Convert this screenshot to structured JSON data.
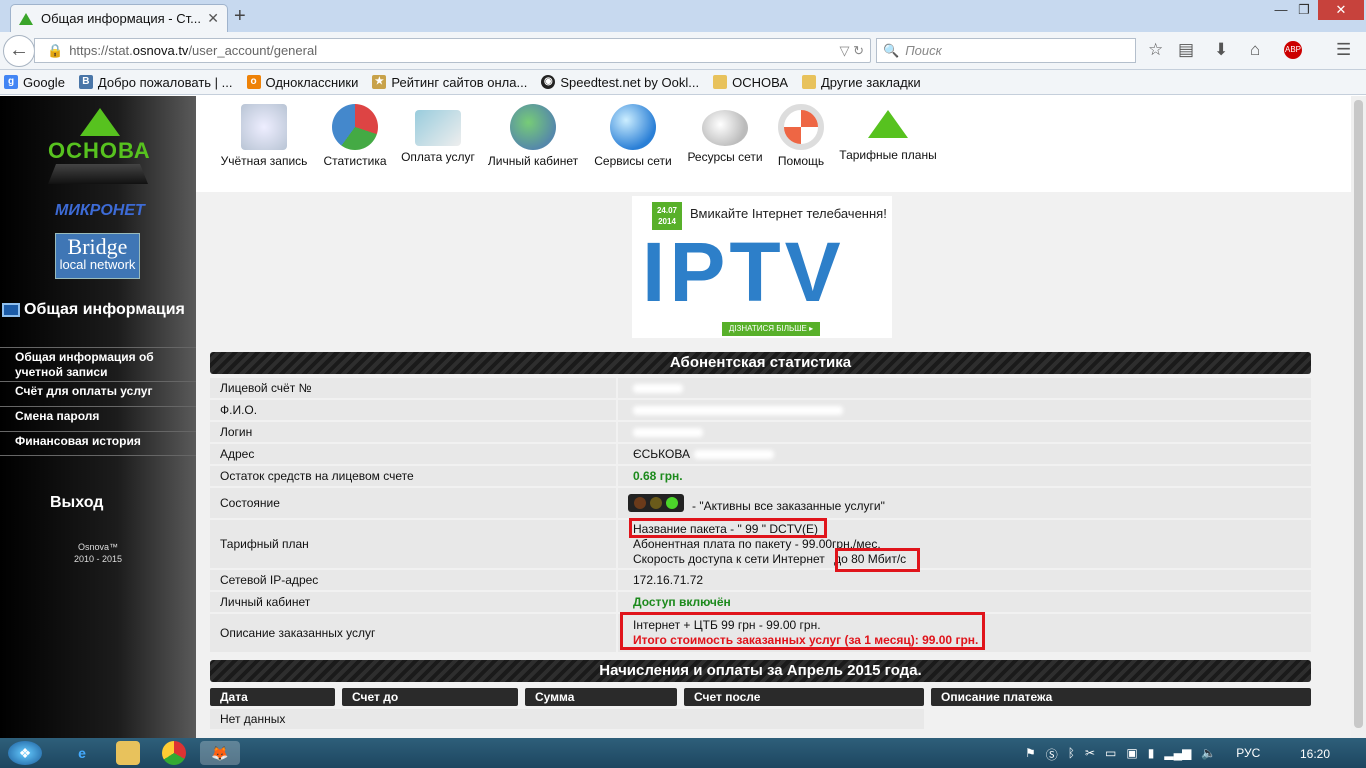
{
  "browser": {
    "tab_title": "Общая информация - Ст...",
    "url_prefix": "https://stat.",
    "url_domain": "osnova.tv",
    "url_path": "/user_account/general",
    "search_placeholder": "Поиск",
    "bookmarks": [
      {
        "label": "Google",
        "icon": "google-icon",
        "color": "#4285f4"
      },
      {
        "label": "Добро пожаловать | ...",
        "icon": "vk-icon",
        "color": "#4a76a8"
      },
      {
        "label": "Одноклассники",
        "icon": "odnoklassniki-icon",
        "color": "#ee8208"
      },
      {
        "label": "Рейтинг сайтов онла...",
        "icon": "rating-icon",
        "color": "#c8a24a"
      },
      {
        "label": "Speedtest.net by Ookl...",
        "icon": "speedtest-icon",
        "color": "#222"
      },
      {
        "label": "ОСНОВА",
        "icon": "folder-icon",
        "color": "#e8c25c"
      },
      {
        "label": "Другие закладки",
        "icon": "folder-icon",
        "color": "#e8c25c"
      }
    ]
  },
  "sidebar": {
    "logo_text": "ОСНОВА",
    "mikronet": "МИКРОНЕТ",
    "bridge_line1": "Bridge",
    "bridge_line2": "local network",
    "section_title": "Общая информация",
    "links": [
      "Общая информация об учетной записи",
      "Счёт для оплаты услуг",
      "Смена пароля",
      "Финансовая история"
    ],
    "logout": "Выход",
    "copyright_line1": "Osnova™",
    "copyright_line2": "2010 - 2015"
  },
  "nav": [
    "Учётная запись",
    "Статистика",
    "Оплата услуг",
    "Личный кабинет",
    "Сервисы сети",
    "Ресурсы сети",
    "Помощь",
    "Тарифные планы"
  ],
  "banner": {
    "date": "24.07 2014",
    "heading": "Вмикайте Інтернет телебачення!",
    "iptv": "IPTV",
    "more": "ДІЗНАТИСЯ БІЛЬШЕ ▸"
  },
  "stats": {
    "title": "Абонентская статистика",
    "rows": {
      "account": "Лицевой счёт №",
      "fio": "Ф.И.О.",
      "login": "Логин",
      "address": "Адрес",
      "address_val": "ЄСЬКОВА ",
      "balance": "Остаток средств на лицевом счете",
      "balance_val": "0.68 грн.",
      "state": "Состояние",
      "state_val": "- \"Активны все заказанные услуги\"",
      "tariff": "Тарифный план",
      "tariff_name": "Название пакета - \" 99 \" DCTV(E)",
      "tariff_fee": "Абонентная плата по пакету - 99.00грн./мес.",
      "tariff_speed_label": "Скорость доступа к сети Интернет ",
      "tariff_speed": "до 80 Мбит/с",
      "ip": "Сетевой IP-адрес",
      "ip_val": "172.16.71.72",
      "cabinet": "Личный кабинет",
      "cabinet_val": "Доступ включён",
      "services": "Описание заказанных услуг",
      "services_line": "Інтернет + ЦТБ 99 грн - 99.00 грн.",
      "services_total": "Итого стоимость заказанных услуг (за 1 месяц): 99.00 грн."
    }
  },
  "payments": {
    "title": "Начисления и оплаты за Апрель 2015 года.",
    "headers": [
      "Дата",
      "Счет до",
      "Сумма",
      "Счет после",
      "Описание платежа"
    ],
    "empty": "Нет данных"
  },
  "taskbar": {
    "lang": "РУС",
    "time": "16:20"
  }
}
